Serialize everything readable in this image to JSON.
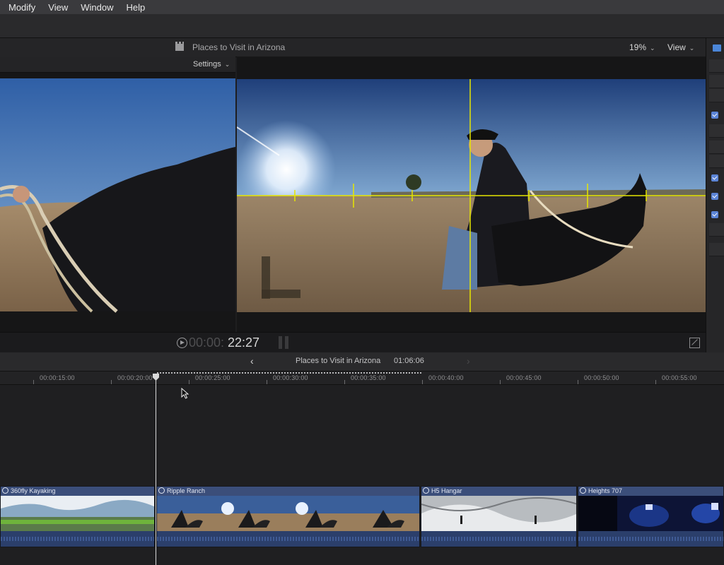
{
  "menubar": {
    "items": [
      "Modify",
      "View",
      "Window",
      "Help"
    ]
  },
  "viewer": {
    "project_title": "Places to Visit in Arizona",
    "zoom": "19%",
    "view_label": "View",
    "settings_label": "Settings",
    "timecode_dim": "00:00:",
    "timecode_main": "22:27"
  },
  "timeline": {
    "project_title": "Places to Visit in Arizona",
    "duration": "01:06:06",
    "ruler": [
      "00:00:15:00",
      "00:00:20:00",
      "00:00:25:00",
      "00:00:30:00",
      "00:00:35:00",
      "00:00:40:00",
      "00:00:45:00",
      "00:00:50:00",
      "00:00:55:00"
    ],
    "clips": [
      {
        "name": "360fly Kayaking",
        "theme": "kayak"
      },
      {
        "name": "Ripple Ranch",
        "theme": "ranch"
      },
      {
        "name": "H5 Hangar",
        "theme": "hangar"
      },
      {
        "name": "Heights 707",
        "theme": "night"
      }
    ]
  },
  "colors": {
    "accent": "#4b86d9",
    "guide": "#e6e600",
    "clip_header": "#3b4e7a"
  },
  "icons": {
    "viewer_title": "clapperboard-icon",
    "inspector": "film-icon",
    "back": "chevron-left-icon",
    "forward": "chevron-right-icon"
  }
}
